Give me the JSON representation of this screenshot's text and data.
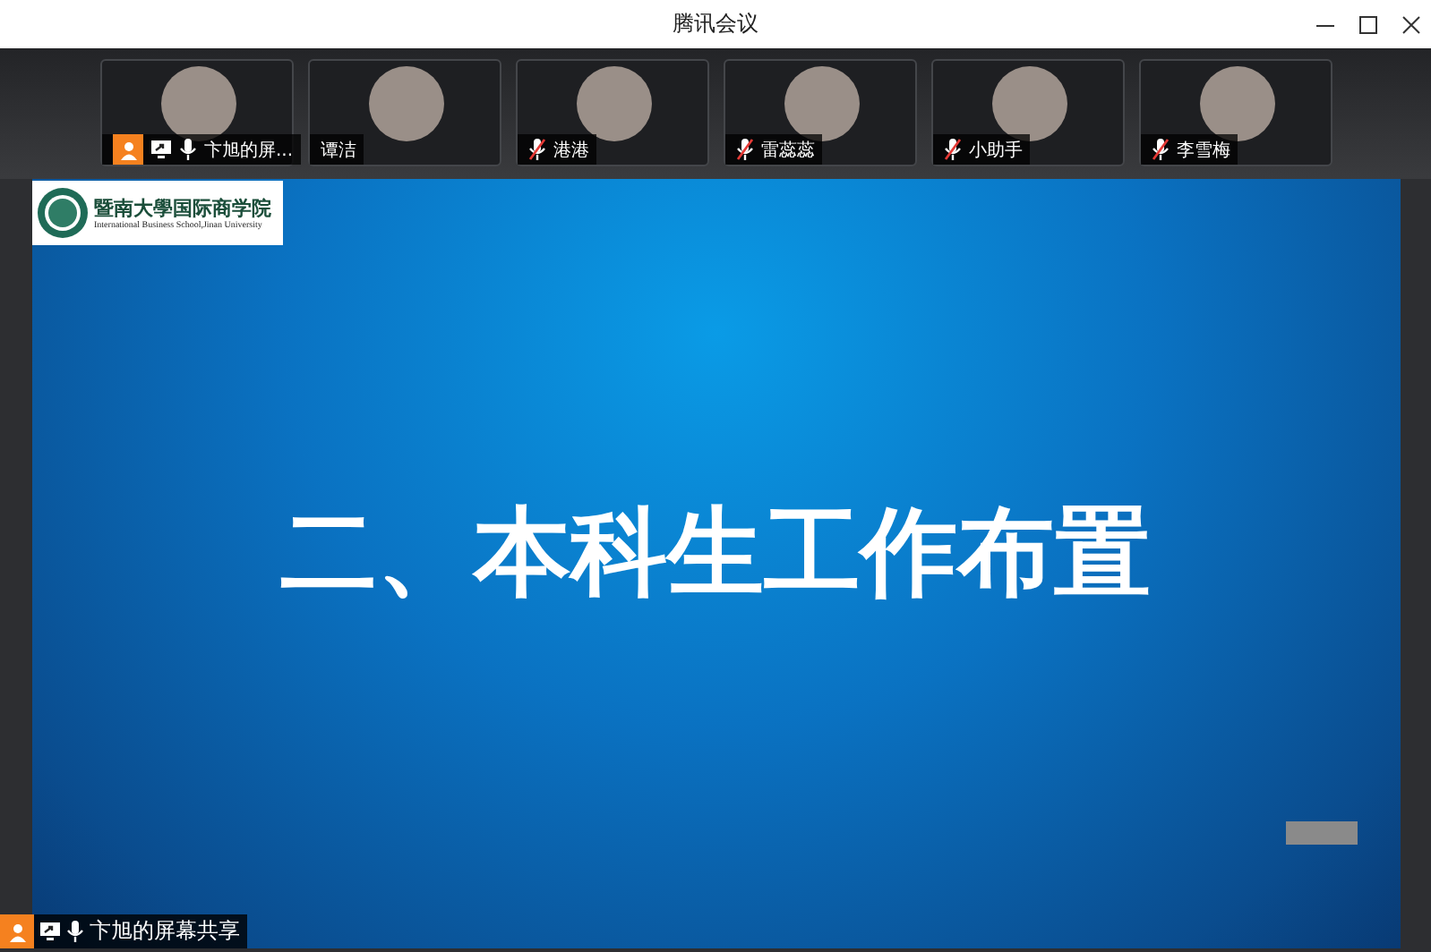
{
  "window": {
    "title": "腾讯会议"
  },
  "participants": [
    {
      "name": "卞旭的屏...",
      "host": true,
      "sharing": true,
      "mic_icon": true,
      "muted": false
    },
    {
      "name": "谭洁",
      "host": false,
      "sharing": false,
      "mic_icon": false
    },
    {
      "name": "港港",
      "host": false,
      "sharing": false,
      "mic_icon": true,
      "muted": true
    },
    {
      "name": "雷蕊蕊",
      "host": false,
      "sharing": false,
      "mic_icon": true,
      "muted": true
    },
    {
      "name": "小助手",
      "host": false,
      "sharing": false,
      "mic_icon": true,
      "muted": true
    },
    {
      "name": "李雪梅",
      "host": false,
      "sharing": false,
      "mic_icon": true,
      "muted": true
    }
  ],
  "slide": {
    "logo_name": "暨南大學国际商学院",
    "logo_subtitle": "International Business School,Jinan University",
    "title": "二、本科生工作布置"
  },
  "share_label": {
    "name": "卞旭的屏幕共享",
    "host": true,
    "sharing": true,
    "mic_icon": true,
    "muted": false
  }
}
